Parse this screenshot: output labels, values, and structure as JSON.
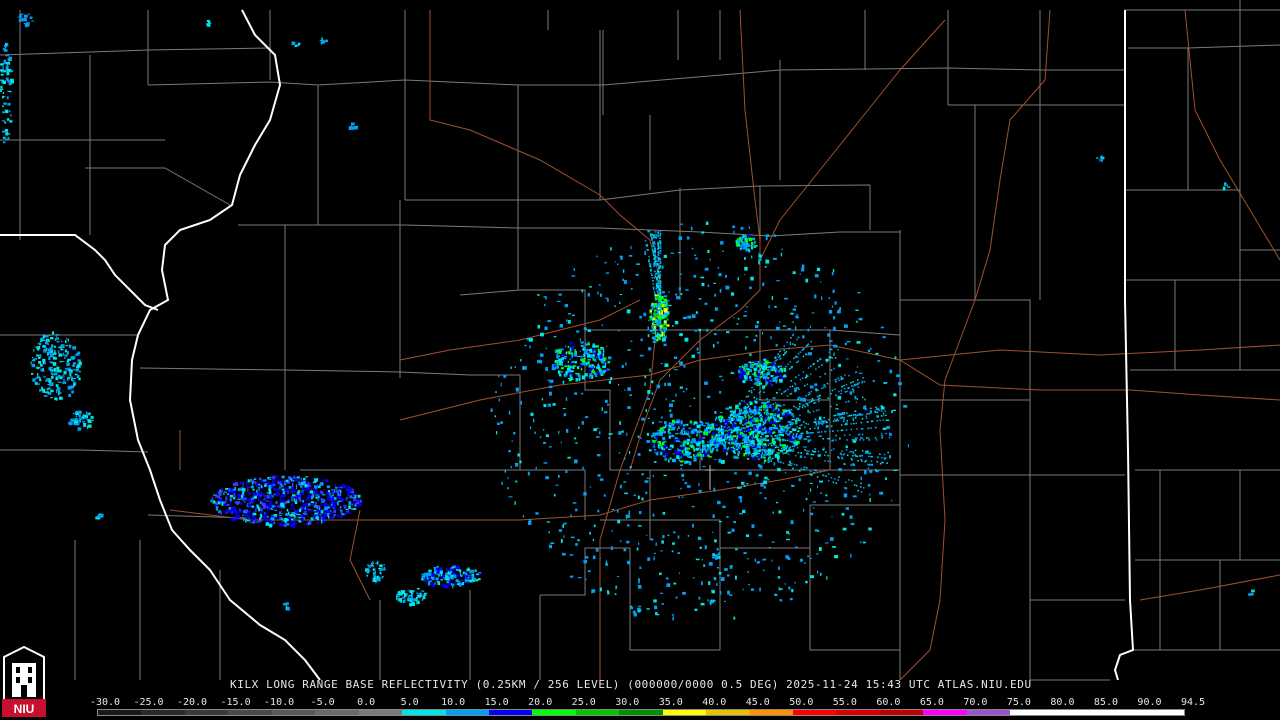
{
  "product": {
    "caption": "KILX LONG RANGE BASE REFLECTIVITY (0.25KM / 256 LEVEL) (000000/0000 0.5 DEG) 2025-11-24 15:43 UTC  ATLAS.NIU.EDU"
  },
  "logo": {
    "text": "NIU",
    "color": "#c8102e"
  },
  "color_scale": {
    "labels": [
      "-30.0",
      "-25.0",
      "-20.0",
      "-15.0",
      "-10.0",
      "-5.0",
      "0.0",
      "5.0",
      "10.0",
      "15.0",
      "20.0",
      "25.0",
      "30.0",
      "35.0",
      "40.0",
      "45.0",
      "50.0",
      "55.0",
      "60.0",
      "65.0",
      "70.0",
      "75.0",
      "80.0",
      "85.0",
      "90.0",
      "94.5"
    ],
    "colors": [
      "#1a1a1a",
      "#2a2a2a",
      "#3a3a3a",
      "#4a4a4a",
      "#5a5a5a",
      "#6a6a6a",
      "#7a7a7a",
      "#00e6e6",
      "#00a0f6",
      "#0000f6",
      "#00ff00",
      "#00c800",
      "#009000",
      "#ffff00",
      "#e7c000",
      "#ff9000",
      "#ff0000",
      "#d60000",
      "#c00000",
      "#ff00ff",
      "#9955c9",
      "#ffffff",
      "#ffffff",
      "#ffffff",
      "#ffffff"
    ]
  },
  "map_colors": {
    "background": "#000000",
    "county_lines": "#808080",
    "state_lines": "#ffffff",
    "highways": "#a0522d"
  }
}
